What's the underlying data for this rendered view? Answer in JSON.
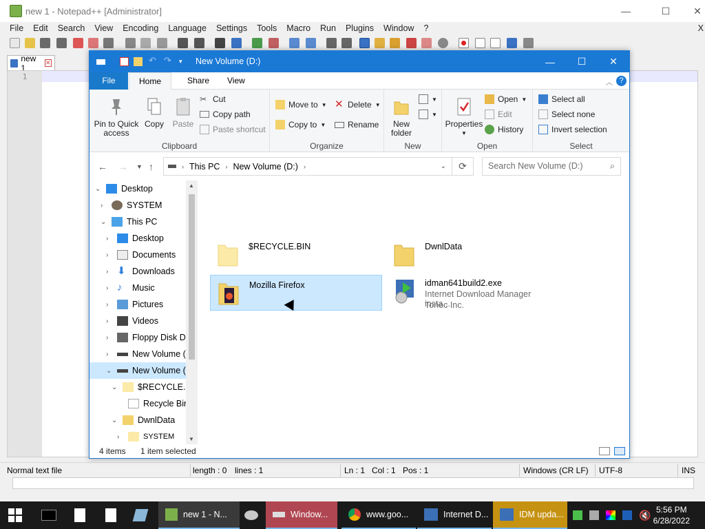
{
  "npp": {
    "title": "new 1 - Notepad++ [Administrator]",
    "menu": [
      "File",
      "Edit",
      "Search",
      "View",
      "Encoding",
      "Language",
      "Settings",
      "Tools",
      "Macro",
      "Run",
      "Plugins",
      "Window",
      "?"
    ],
    "close_x": "X",
    "tab": "new 1",
    "line_number": "1",
    "status": {
      "filetype": "Normal text file",
      "length": "length : 0",
      "lines": "lines : 1",
      "ln": "Ln : 1",
      "col": "Col : 1",
      "pos": "Pos : 1",
      "eol": "Windows (CR LF)",
      "encoding": "UTF-8",
      "mode": "INS"
    }
  },
  "explorer": {
    "title": "New Volume (D:)",
    "tabs": {
      "file": "File",
      "home": "Home",
      "share": "Share",
      "view": "View"
    },
    "ribbon": {
      "pin": "Pin to Quick access",
      "copy": "Copy",
      "paste": "Paste",
      "cut": "Cut",
      "copy_path": "Copy path",
      "paste_shortcut": "Paste shortcut",
      "clipboard": "Clipboard",
      "move_to": "Move to",
      "copy_to": "Copy to",
      "delete": "Delete",
      "rename": "Rename",
      "organize": "Organize",
      "new_folder": "New folder",
      "new": "New",
      "properties": "Properties",
      "open": "Open",
      "edit": "Edit",
      "history": "History",
      "open_group": "Open",
      "select_all": "Select all",
      "select_none": "Select none",
      "invert_selection": "Invert selection",
      "select": "Select"
    },
    "address": {
      "root": "This PC",
      "current": "New Volume (D:)"
    },
    "search_placeholder": "Search New Volume (D:)",
    "tree": [
      "Desktop",
      "SYSTEM",
      "This PC",
      "Desktop",
      "Documents",
      "Downloads",
      "Music",
      "Pictures",
      "Videos",
      "Floppy Disk Dri",
      "New Volume (C",
      "New Volume (D",
      "$RECYCLE.BIN",
      "Recycle Bin",
      "DwnlData",
      "SYSTEM"
    ],
    "items": {
      "recycle": "$RECYCLE.BIN",
      "dwnldata": "DwnlData",
      "firefox": "Mozilla Firefox",
      "idm_name": "idman641build2.exe",
      "idm_desc": "Internet Download Manager insta...",
      "idm_company": "Tonec Inc."
    },
    "status": {
      "count": "4 items",
      "selected": "1 item selected"
    }
  },
  "taskbar": {
    "npp": "new 1 - N...",
    "windows": "Window...",
    "chrome": "www.goo...",
    "idm": "Internet D...",
    "idm_update": "IDM upda...",
    "time": "5:56 PM",
    "date": "6/28/2022"
  },
  "colors": {
    "accent": "#1b79d6",
    "selection": "#cce8ff",
    "taskbar": "#1a1a1a"
  }
}
